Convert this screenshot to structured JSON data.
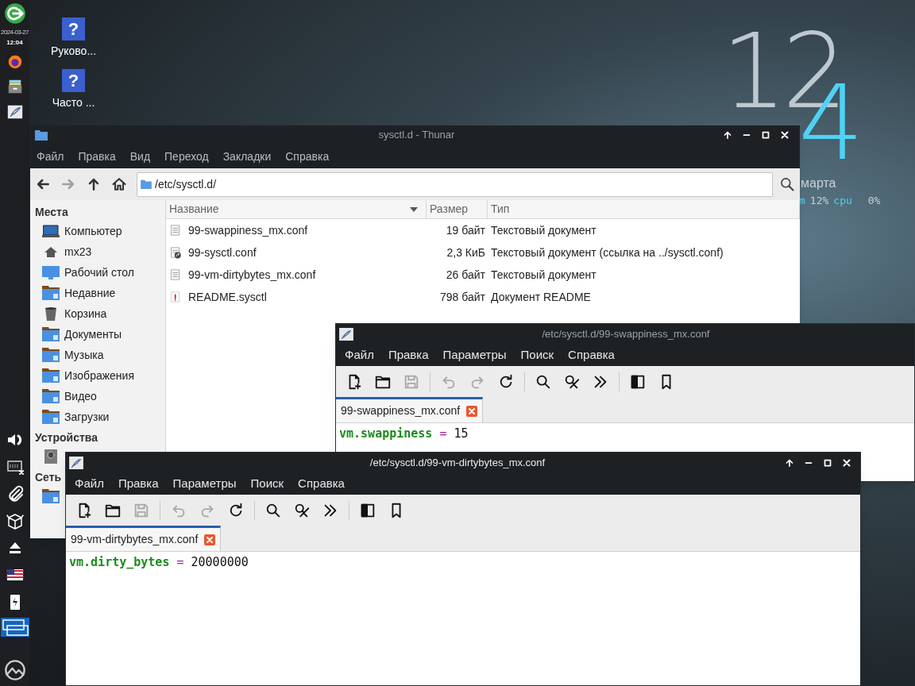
{
  "panel": {
    "date": "2024-03-27",
    "time": "12:04",
    "launchers": [
      {
        "kind": "logout"
      },
      {
        "kind": "browser"
      },
      {
        "kind": "files"
      },
      {
        "kind": "editor"
      }
    ],
    "tray": [
      {
        "kind": "volume"
      },
      {
        "kind": "network"
      },
      {
        "kind": "clip"
      },
      {
        "kind": "box"
      },
      {
        "kind": "eject"
      },
      {
        "kind": "flag"
      },
      {
        "kind": "battery"
      },
      {
        "kind": "pager"
      },
      {
        "kind": "logo"
      }
    ]
  },
  "desktop_icons": [
    {
      "glyph": "?",
      "label": "Руково..."
    },
    {
      "glyph": "?",
      "label": "Часто ..."
    }
  ],
  "clock": {
    "hours": "12",
    "minutes": "4",
    "date": "марта",
    "stats": [
      "m",
      "12%",
      "cpu",
      "0%"
    ]
  },
  "thunar": {
    "title": "sysctl.d - Thunar",
    "menu": [
      "Файл",
      "Правка",
      "Вид",
      "Переход",
      "Закладки",
      "Справка"
    ],
    "nav": [
      {
        "kind": "back",
        "disabled": false
      },
      {
        "kind": "forward",
        "disabled": true
      },
      {
        "kind": "up",
        "disabled": false
      },
      {
        "kind": "home",
        "disabled": false
      }
    ],
    "path": "/etc/sysctl.d/",
    "sidebar": [
      {
        "title": "Места",
        "items": [
          {
            "kind": "computer",
            "label": "Компьютер"
          },
          {
            "kind": "home",
            "label": "mx23"
          },
          {
            "kind": "desktop",
            "label": "Рабочий стол"
          },
          {
            "kind": "folder",
            "label": "Недавние"
          },
          {
            "kind": "trash",
            "label": "Корзина"
          },
          {
            "kind": "folder",
            "label": "Документы"
          },
          {
            "kind": "folder",
            "label": "Музыка"
          },
          {
            "kind": "folder",
            "label": "Изображения"
          },
          {
            "kind": "folder",
            "label": "Видео"
          },
          {
            "kind": "folder",
            "label": "Загрузки"
          }
        ]
      },
      {
        "title": "Устройства",
        "items": [
          {
            "kind": "drive"
          }
        ]
      },
      {
        "title": "Сеть",
        "items": [
          {
            "kind": "folder"
          }
        ]
      }
    ],
    "columns": [
      "Название",
      "Размер",
      "Тип"
    ],
    "rows": [
      {
        "kind": "text",
        "name": "99-swappiness_mx.conf",
        "size": "19 байт",
        "type": "Текстовый документ"
      },
      {
        "kind": "link",
        "name": "99-sysctl.conf",
        "size": "2,3 КиБ",
        "type": "Текстовый документ (ссылка на ../sysctl.conf)"
      },
      {
        "kind": "text",
        "name": "99-vm-dirtybytes_mx.conf",
        "size": "26 байт",
        "type": "Текстовый документ"
      },
      {
        "kind": "readme",
        "name": "README.sysctl",
        "size": "798 байт",
        "type": "Документ README"
      }
    ]
  },
  "editors": [
    {
      "title": "/etc/sysctl.d/99-swappiness_mx.conf",
      "controls": false,
      "menu": [
        "Файл",
        "Правка",
        "Параметры",
        "Поиск",
        "Справка"
      ],
      "toolbar": [
        [
          {
            "kind": "new",
            "disabled": false
          },
          {
            "kind": "open",
            "disabled": false
          },
          {
            "kind": "save",
            "disabled": true
          }
        ],
        [
          {
            "kind": "undo",
            "disabled": true
          },
          {
            "kind": "redo",
            "disabled": true
          },
          {
            "kind": "reload",
            "disabled": false
          }
        ],
        [
          {
            "kind": "find",
            "disabled": false
          },
          {
            "kind": "replace",
            "disabled": false
          },
          {
            "kind": "more",
            "disabled": false
          }
        ],
        [
          {
            "kind": "sidebar",
            "disabled": false
          },
          {
            "kind": "bookmark",
            "disabled": false
          }
        ]
      ],
      "tabs": [
        {
          "label": "99-swappiness_mx.conf",
          "selected": true
        }
      ],
      "code": {
        "key": "vm.swappiness",
        "op": "=",
        "value": "15"
      }
    },
    {
      "title": "/etc/sysctl.d/99-vm-dirtybytes_mx.conf",
      "controls": true,
      "menu": [
        "Файл",
        "Правка",
        "Параметры",
        "Поиск",
        "Справка"
      ],
      "toolbar": [
        [
          {
            "kind": "new",
            "disabled": false
          },
          {
            "kind": "open",
            "disabled": false
          },
          {
            "kind": "save",
            "disabled": true
          }
        ],
        [
          {
            "kind": "undo",
            "disabled": true
          },
          {
            "kind": "redo",
            "disabled": true
          },
          {
            "kind": "reload",
            "disabled": false
          }
        ],
        [
          {
            "kind": "find",
            "disabled": false
          },
          {
            "kind": "replace",
            "disabled": false
          },
          {
            "kind": "more",
            "disabled": false
          }
        ],
        [
          {
            "kind": "sidebar",
            "disabled": false
          },
          {
            "kind": "bookmark",
            "disabled": false
          }
        ]
      ],
      "tabs": [
        {
          "label": "99-vm-dirtybytes_mx.conf",
          "selected": true
        }
      ],
      "code": {
        "key": "vm.dirty_bytes",
        "op": "=",
        "value": "20000000"
      }
    }
  ]
}
